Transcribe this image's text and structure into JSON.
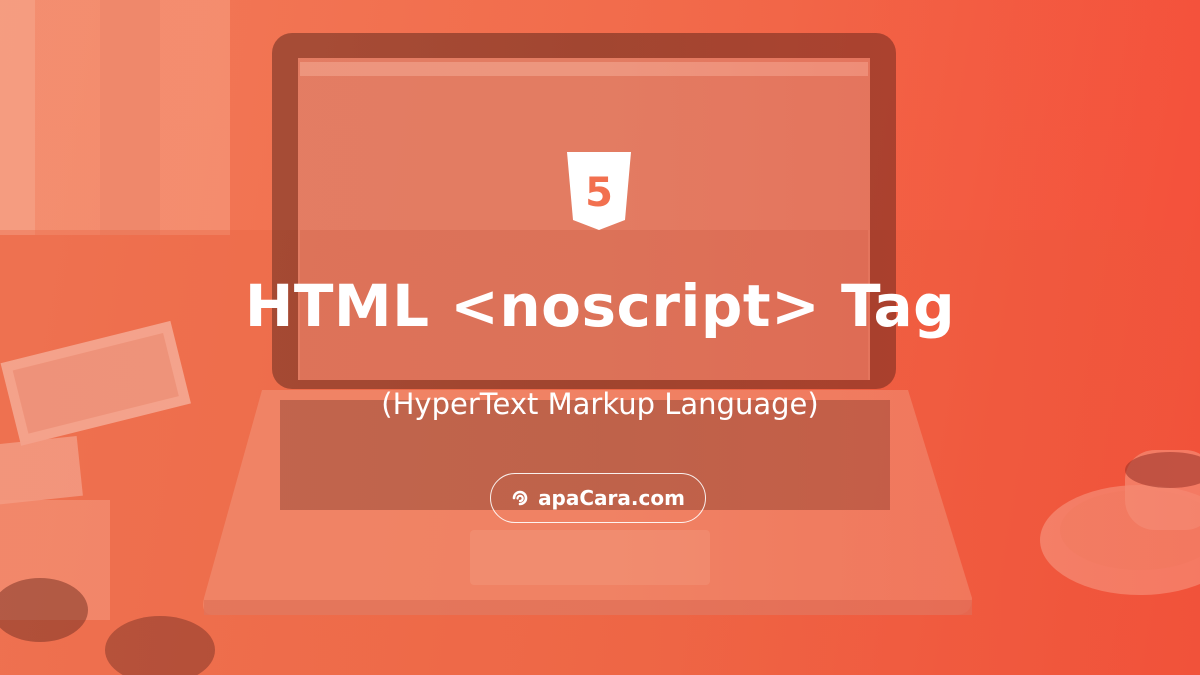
{
  "banner": {
    "title": "HTML <noscript> Tag",
    "subtitle": "(HyperText Markup Language)",
    "logo_icon": "html5-logo-icon",
    "logo_number": "5",
    "badge": {
      "icon": "apacara-logo-icon",
      "label": "apaCara.com"
    }
  },
  "colors": {
    "overlay": "#f2704f",
    "text": "#ffffff"
  }
}
